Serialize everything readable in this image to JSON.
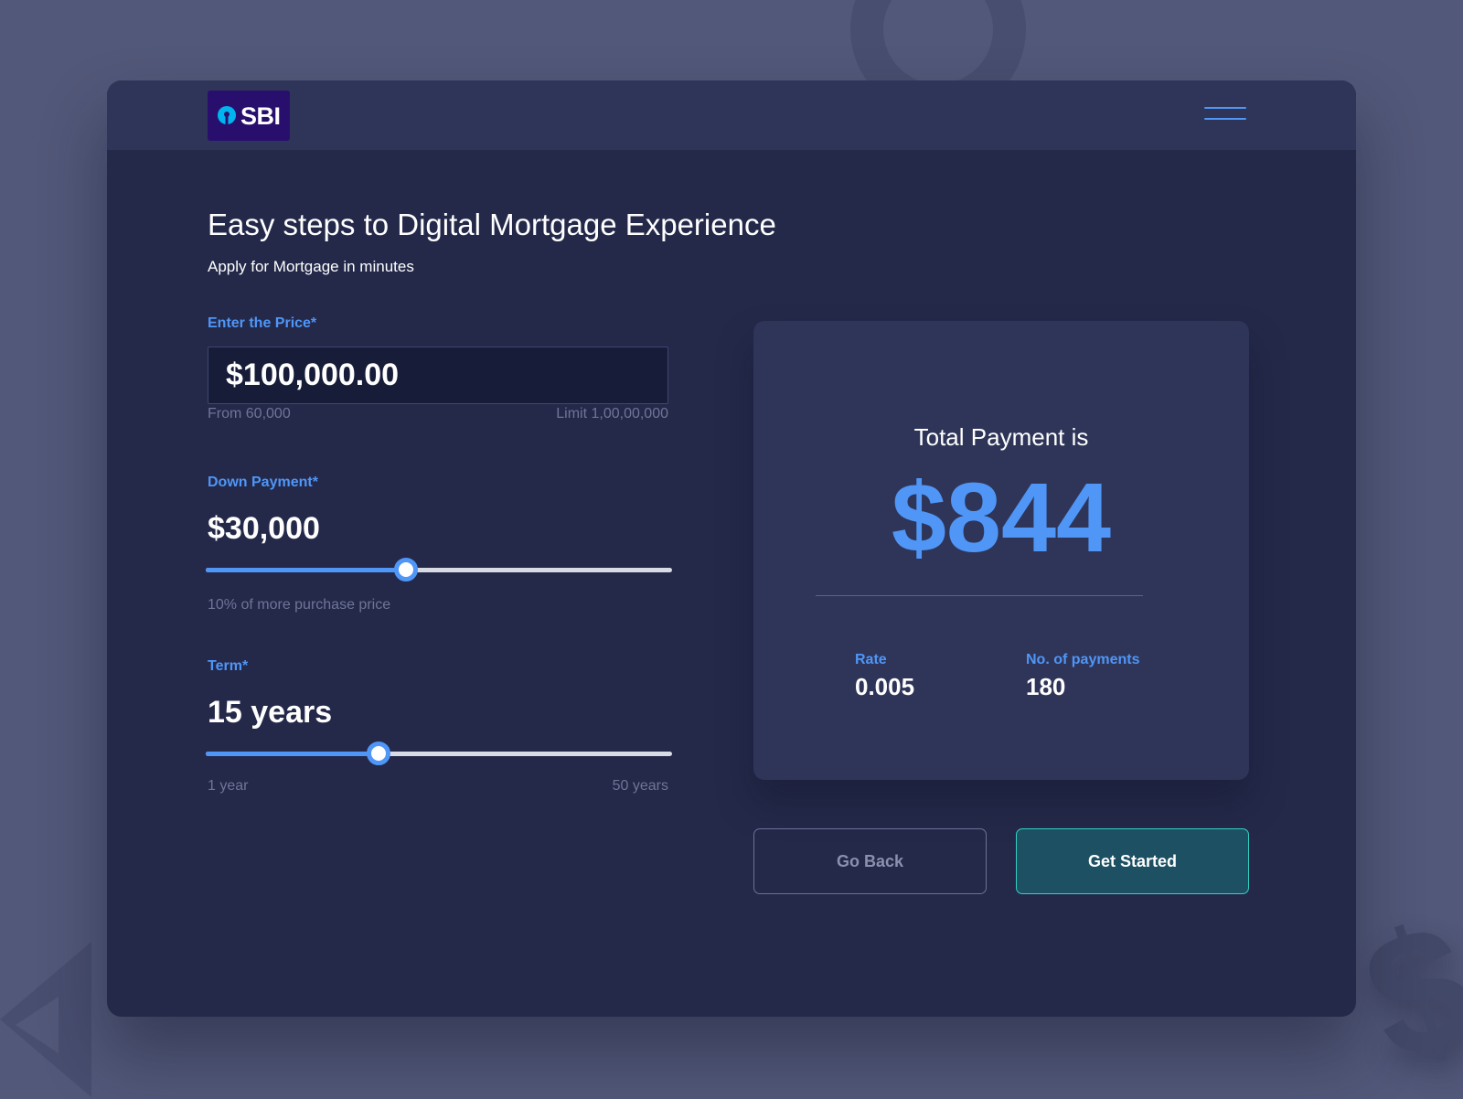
{
  "brand": {
    "logo_text": "SBI",
    "logo_background": "#280f6e",
    "logo_mark_color": "#00b5ef"
  },
  "header": {
    "menu_icon": "hamburger-menu-icon"
  },
  "page": {
    "title": "Easy steps to Digital Mortgage Experience",
    "subtitle": "Apply for Mortgage in minutes"
  },
  "price": {
    "label": "Enter the Price*",
    "value": "$100,000.00",
    "min_hint": "From 60,000",
    "max_hint": "Limit 1,00,00,000"
  },
  "down_payment": {
    "label": "Down Payment*",
    "value": "$30,000",
    "slider_fraction": 0.43,
    "hint": "10% of more purchase price"
  },
  "term": {
    "label": "Term*",
    "value": "15 years",
    "slider_fraction": 0.37,
    "min_label": "1 year",
    "max_label": "50 years"
  },
  "result": {
    "total_label": "Total Payment is",
    "total_value": "$844",
    "rate_label": "Rate",
    "rate_value": "0.005",
    "payments_label": "No. of payments",
    "payments_value": "180"
  },
  "actions": {
    "back_label": "Go Back",
    "start_label": "Get Started"
  },
  "colors": {
    "accent": "#4f96f7",
    "background": "#525879",
    "window": "#24294a",
    "panel": "#2f3558",
    "primary_button": "#1e5063",
    "primary_button_border": "#33d0c3"
  }
}
